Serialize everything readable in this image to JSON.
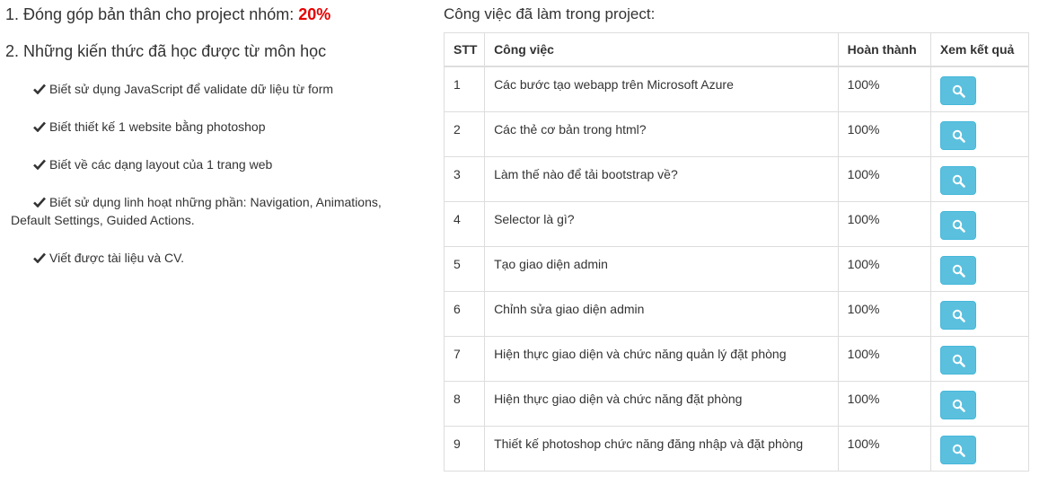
{
  "left": {
    "heading1_prefix": "1. Đóng góp bản thân cho project nhóm: ",
    "heading1_value": "20%",
    "heading2": "2. Những kiến thức đã học được từ môn học",
    "skills": [
      "Biết sử dụng JavaScript để validate dữ liệu từ form",
      "Biết thiết kế 1 website bằng photoshop",
      "Biết về các dạng layout của 1 trang web",
      "Biết sử dụng linh hoạt những phần: Navigation, Animations, Default Settings, Guided Actions.",
      "Viết được tài liệu và CV."
    ]
  },
  "right": {
    "title": "Công việc đã làm trong project:",
    "columns": [
      "STT",
      "Công việc",
      "Hoàn thành",
      "Xem kết quả"
    ],
    "rows": [
      {
        "stt": "1",
        "task": "Các bước tạo webapp trên Microsoft Azure",
        "done": "100%"
      },
      {
        "stt": "2",
        "task": "Các thẻ cơ bản trong html?",
        "done": "100%"
      },
      {
        "stt": "3",
        "task": "Làm thế nào để tải bootstrap về?",
        "done": "100%"
      },
      {
        "stt": "4",
        "task": "Selector là gì?",
        "done": "100%"
      },
      {
        "stt": "5",
        "task": "Tạo giao diện admin",
        "done": "100%"
      },
      {
        "stt": "6",
        "task": "Chỉnh sửa giao diện admin",
        "done": "100%"
      },
      {
        "stt": "7",
        "task": "Hiện thực giao diện và chức năng quản lý đặt phòng",
        "done": "100%"
      },
      {
        "stt": "8",
        "task": "Hiện thực giao diện và chức năng đặt phòng",
        "done": "100%"
      },
      {
        "stt": "9",
        "task": "Thiết kế photoshop chức năng đăng nhập và đặt phòng",
        "done": "100%"
      }
    ],
    "button_icon": "search-icon",
    "button_color": "#5bc0de"
  },
  "colors": {
    "highlight": "#e60000",
    "text": "#333333"
  }
}
